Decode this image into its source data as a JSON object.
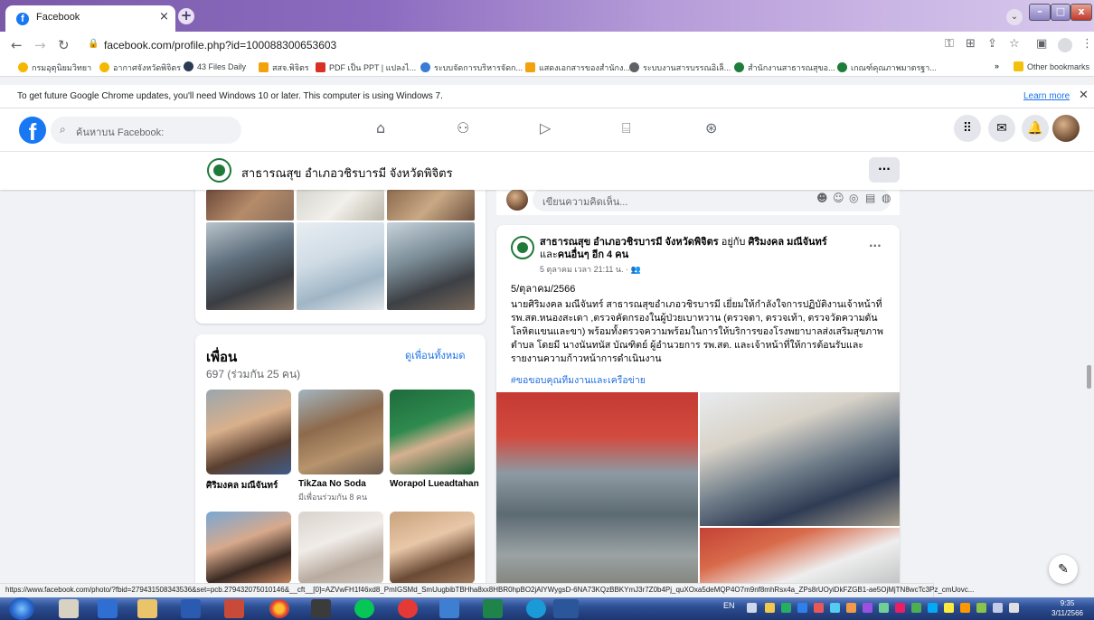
{
  "browser": {
    "tab_title": "Facebook",
    "tab_close": "×",
    "new_tab": "+",
    "tab_search": "⌄",
    "win_min": "–",
    "win_max": "□",
    "win_close": "x",
    "url": "facebook.com/profile.php?id=100088300653603",
    "bookmarks": [
      "กรมอุตุนิยมวิทยา",
      "อากาศจังหวัดพิจิตร",
      "43 Files Daily",
      "สสจ.พิจิตร",
      "PDF เป็น PPT | แปลงไ...",
      "ระบบจัดการบริหารจัดก...",
      "แสดงเอกสารของสำนักง...",
      "ระบบงานสารบรรณอิเล็...",
      "สำนักงานสาธารณสุขอ...",
      "เกณฑ์คุณภาพมาตรฐา..."
    ],
    "bookmarks_more": "»",
    "other_bookmarks": "Other bookmarks",
    "info_message": "To get future Google Chrome updates, you'll need Windows 10 or later. This computer is using Windows 7.",
    "learn_more": "Learn more",
    "info_close": "✕",
    "status_url": "https://www.facebook.com/photo/?fbid=279431508343536&set=pcb.279432075010146&__cft__[0]=AZVwFH1f46xd8_PmIGSMd_SmUugbibTBHha8xx8HBR0hpBO2jAlYWygsD-6NA73KQzBBKYmJ3r7Z0b4Pj_quXOxa5deMQP4O7m9nf8mhRsx4a_ZPs8rUOyiDkFZGB1-ae5OjMjTN8wcTc3Pz_cmUovc..."
  },
  "facebook": {
    "search_placeholder": "ค้นหาบน Facebook:",
    "page_name": "สาธารณสุข อำเภอวชิรบารมี จังหวัดพิจิตร",
    "more_dots": "···",
    "friends": {
      "title": "เพื่อน",
      "count": "697 (ร่วมกัน 25 คน)",
      "see_all": "ดูเพื่อนทั้งหมด",
      "list": [
        {
          "name": "ศิริมงคล มณีจันทร์",
          "mutual": ""
        },
        {
          "name": "TikZaa No Soda",
          "mutual": "มีเพื่อนร่วมกัน 8 คน"
        },
        {
          "name": "Worapol Lueadtahan",
          "mutual": ""
        }
      ]
    },
    "comment_placeholder": "เขียนความคิดเห็น...",
    "post": {
      "author": "สาธารณสุข อำเภอวชิรบารมี จังหวัดพิจิตร",
      "with_text": " อยู่กับ ",
      "with_name": "ศิริมงคล มณีจันทร์",
      "and_text": "และ",
      "others": "คนอื่นๆ อีก 4 คน",
      "meta": "5 ตุลาคม เวลา 21:11 น. · 👥",
      "date_line": "5/ตุลาคม/2566",
      "body": "นายศิริมงคล มณีจันทร์ สาธารณสุขอำเภอวชิรบารมี เยี่ยมให้กำลังใจการปฏิบัติงานเจ้าหน้าที่ รพ.สต.หนองสะเดา ,ตรวจคัดกรองในผู้ป่วยเบาหวาน (ตรวจตา, ตรวจเท้า, ตรวจวัดความดันโลหิตแขนและขา) พร้อมทั้งตรวจความพร้อมในการให้บริการของโรงพยาบาลส่งเสริมสุขภาพตำบล โดยมี นางนันทนัส บัณฑิตย์ ผู้อำนวยการ รพ.สต. และเจ้าหน้าที่ให้การต้อนรับและรายงานความก้าวหน้าการดำเนินงาน",
      "hashtag": "#ขอขอบคุณทีมงานและเครือข่าย"
    }
  },
  "taskbar": {
    "lang": "EN",
    "time": "9:35",
    "date": "3/11/2566"
  }
}
